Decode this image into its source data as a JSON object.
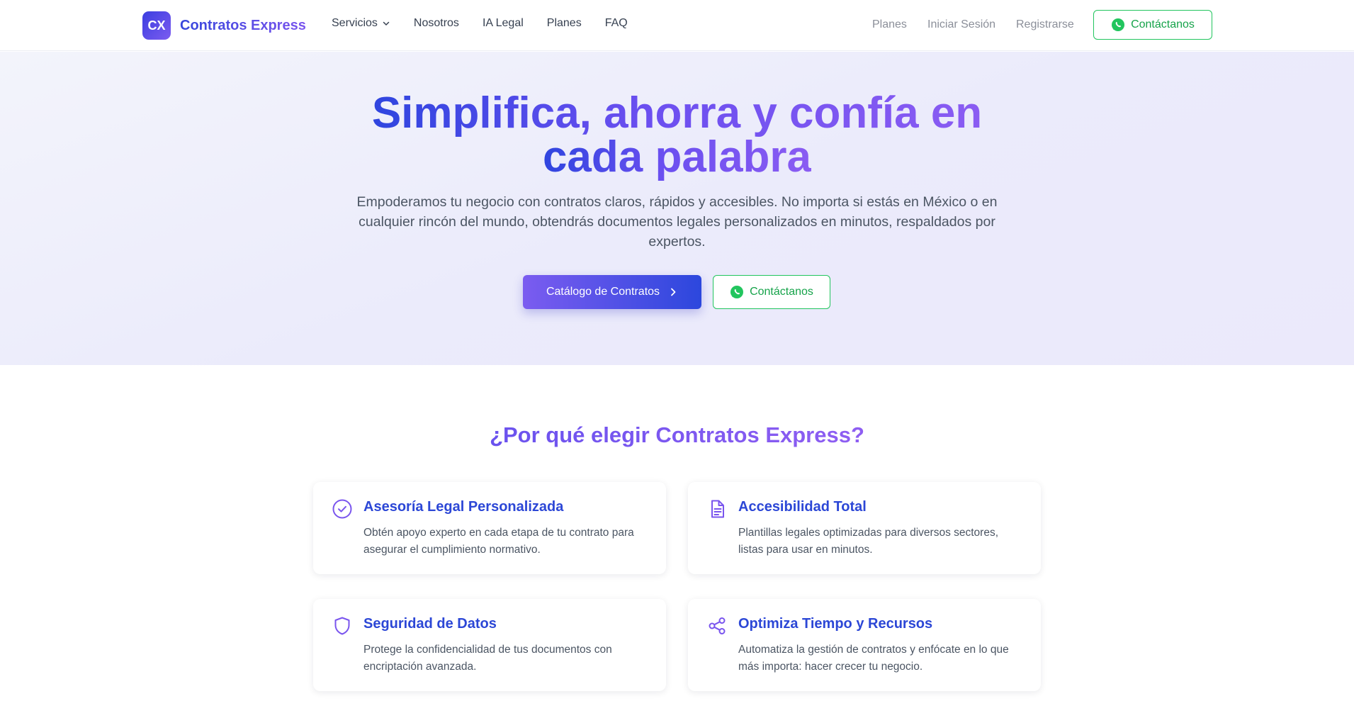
{
  "colors": {
    "brand_blue": "#2c47dd",
    "brand_purple": "#7b5cf0",
    "whatsapp_green": "#22c55e",
    "hero_bg": "#ebebfb"
  },
  "header": {
    "logo_badge": "CX",
    "logo_name": "Contratos Express",
    "nav": [
      {
        "label": "Servicios",
        "icon": "chevron-down-icon"
      },
      {
        "label": "Nosotros"
      },
      {
        "label": "IA Legal"
      },
      {
        "label": "Planes"
      },
      {
        "label": "FAQ"
      }
    ],
    "right": {
      "planes": "Planes",
      "login": "Iniciar Sesión",
      "register": "Registrarse",
      "contact": "Contáctanos",
      "contact_icon": "whatsapp-icon"
    }
  },
  "hero": {
    "title_line1": "Simplifica, ahorra y confía en",
    "title_line2": "cada palabra",
    "subtitle": "Empoderamos tu negocio con contratos claros, rápidos y accesibles. No importa si estás en México o en cualquier rincón del mundo, obtendrás documentos legales personalizados en minutos, respaldados por expertos.",
    "primary_button": "Catálogo de Contratos",
    "primary_icon": "chevron-right-icon",
    "secondary_button": "Contáctanos",
    "secondary_icon": "whatsapp-icon"
  },
  "features": {
    "title": "¿Por qué elegir Contratos Express?",
    "items": [
      {
        "icon": "check-circle-icon",
        "title": "Asesoría Legal Personalizada",
        "desc": "Obtén apoyo experto en cada etapa de tu contrato para asegurar el cumplimiento normativo."
      },
      {
        "icon": "document-icon",
        "title": "Accesibilidad Total",
        "desc": "Plantillas legales optimizadas para diversos sectores, listas para usar en minutos."
      },
      {
        "icon": "shield-icon",
        "title": "Seguridad de Datos",
        "desc": "Protege la confidencialidad de tus documentos con encriptación avanzada."
      },
      {
        "icon": "share-icon",
        "title": "Optimiza Tiempo y Recursos",
        "desc": "Automatiza la gestión de contratos y enfócate en lo que más importa: hacer crecer tu negocio."
      }
    ]
  }
}
